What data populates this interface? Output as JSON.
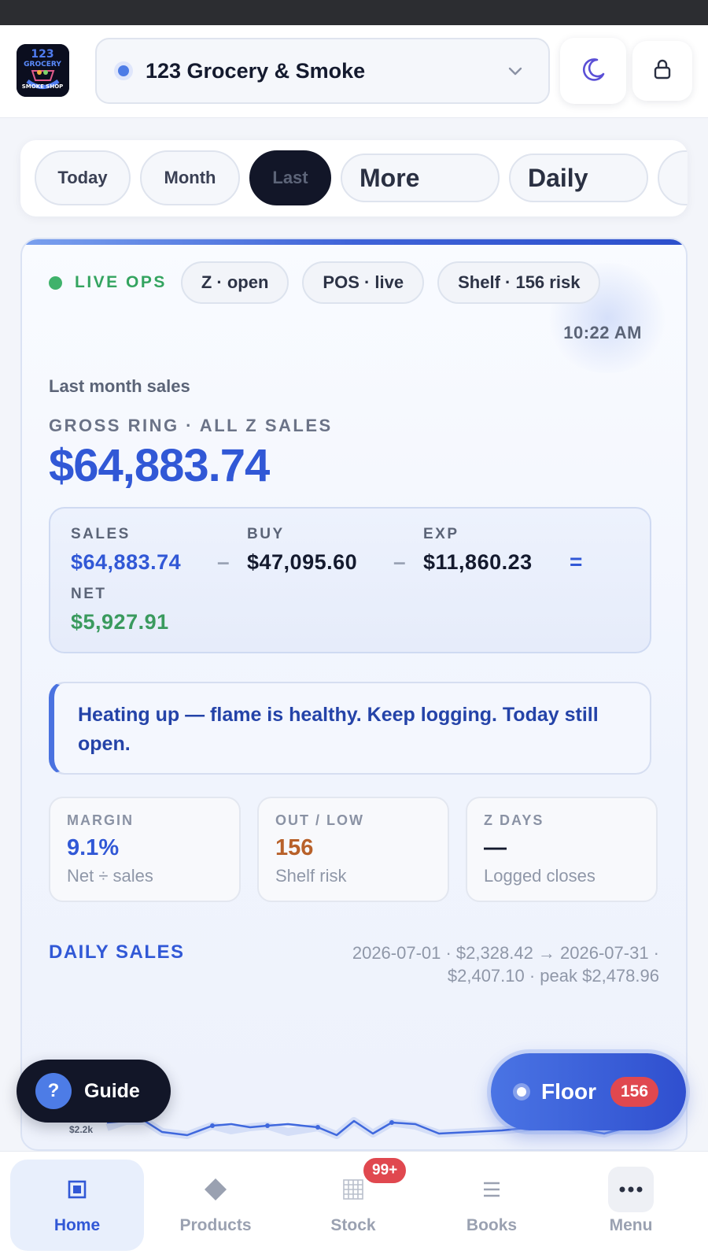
{
  "header": {
    "store_name": "123 Grocery & Smoke"
  },
  "range_tabs": [
    {
      "label": "Today",
      "active": false
    },
    {
      "label": "Month",
      "active": false
    },
    {
      "label": "Last",
      "active": true
    },
    {
      "label": "More",
      "active": false
    },
    {
      "label": "Daily",
      "active": false
    }
  ],
  "live": {
    "label": "LIVE OPS",
    "pills": [
      "Z · open",
      "POS · live",
      "Shelf · 156 risk"
    ],
    "time": "10:22 AM"
  },
  "summary": {
    "period": "Last month sales",
    "metric_label": "GROSS RING · ALL Z SALES",
    "gross": "$64,883.74"
  },
  "equation": {
    "sales_label": "SALES",
    "sales_value": "$64,883.74",
    "buy_label": "BUY",
    "buy_value": "$47,095.60",
    "exp_label": "EXP",
    "exp_value": "$11,860.23",
    "net_label": "NET",
    "net_value": "$5,927.91",
    "minus": "–",
    "equals": "="
  },
  "message": "Heating up — flame is healthy. Keep logging. Today still open.",
  "stats": [
    {
      "label": "MARGIN",
      "value": "9.1%",
      "sub": "Net ÷ sales",
      "color": "#3158d6"
    },
    {
      "label": "OUT / LOW",
      "value": "156",
      "sub": "Shelf risk",
      "color": "#b8612a"
    },
    {
      "label": "Z DAYS",
      "value": "—",
      "sub": "Logged closes",
      "color": "#141a2e"
    }
  ],
  "daily": {
    "title": "DAILY SALES",
    "summary": "2026-07-01 · $2,328.42 → 2026-07-31 · $2,407.10 · peak $2,478.96",
    "axis_label": "$2.2k"
  },
  "fabs": {
    "guide_q": "?",
    "guide_label": "Guide",
    "floor_label": "Floor",
    "floor_badge": "156"
  },
  "nav": [
    {
      "label": "Home",
      "icon": "home-icon",
      "active": true
    },
    {
      "label": "Products",
      "icon": "diamond-icon",
      "active": false
    },
    {
      "label": "Stock",
      "icon": "grid-icon",
      "active": false,
      "badge": "99+"
    },
    {
      "label": "Books",
      "icon": "lines-icon",
      "active": false
    },
    {
      "label": "Menu",
      "icon": "more-icon",
      "active": false
    }
  ],
  "colors": {
    "accent": "#3158d6",
    "success": "#34a460",
    "warning": "#b8612a",
    "danger": "#e0484f",
    "dark": "#121628"
  }
}
